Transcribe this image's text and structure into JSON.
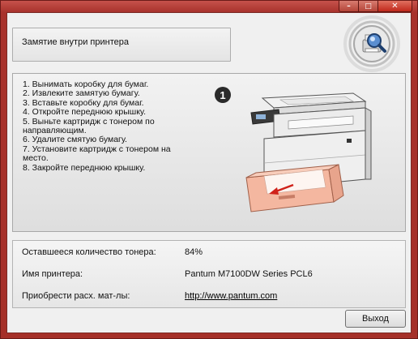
{
  "window": {
    "controls": {
      "minimize": "–",
      "maximize": "□",
      "close": "✕"
    }
  },
  "header": {
    "title": "Замятие внутри принтера"
  },
  "instructions": {
    "step_number": "1",
    "steps": [
      "1. Вынимать коробку для бумаг.",
      "2. Извлеките замятую бумагу.",
      "3. Вставьте коробку для бумаг.",
      "4. Откройте переднюю крышку.",
      "5. Выньте картридж с тонером по направляющим.",
      "6. Удалите смятую бумагу.",
      "7. Установите картридж с тонером на место.",
      "8. Закройте переднюю крышку."
    ]
  },
  "info": {
    "toner_label": "Оставшееся количество тонера:",
    "toner_value": "84%",
    "printer_label": "Имя принтера:",
    "printer_value": "Pantum M7100DW Series PCL6",
    "supplies_label": "Приобрести расх. мат-лы:",
    "supplies_link": "http://www.pantum.com"
  },
  "buttons": {
    "exit": "Выход"
  },
  "colors": {
    "window_frame": "#a53029",
    "tray_highlight": "#f4b7a0",
    "arrow": "#d0221a"
  }
}
